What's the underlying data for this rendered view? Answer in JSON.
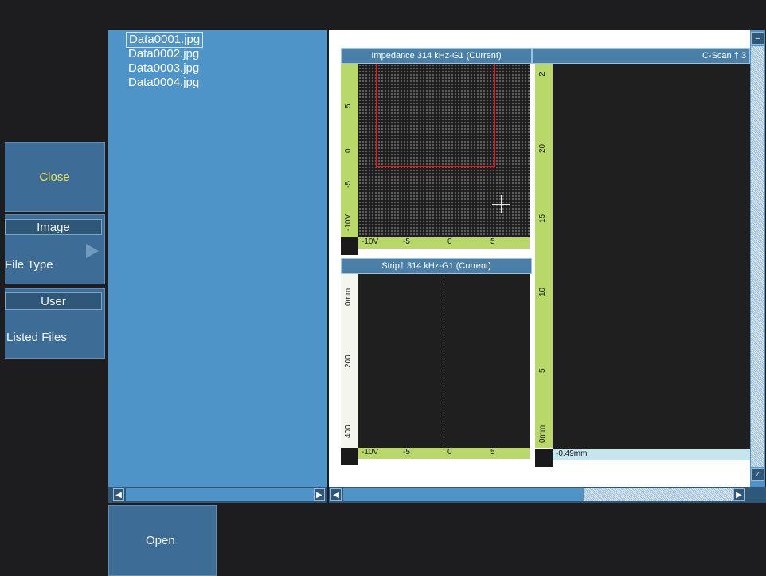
{
  "menu": {
    "close_label": "Close",
    "image_label": "Image",
    "file_type_label": "File Type",
    "user_label": "User",
    "listed_files_label": "Listed Files"
  },
  "files": [
    {
      "name": "Data0001.jpg",
      "selected": true
    },
    {
      "name": "Data0002.jpg",
      "selected": false
    },
    {
      "name": "Data0003.jpg",
      "selected": false
    },
    {
      "name": "Data0004.jpg",
      "selected": false
    }
  ],
  "footer": {
    "open_label": "Open"
  },
  "preview": {
    "impedance_title": "Impedance 314 kHz-G1 (Current)",
    "strip_title": "Strip† 314 kHz-G1 (Current)",
    "cscan_title": "C-Scan † 3",
    "impedance_y_ticks": [
      "-10V",
      "-5",
      "0",
      "5"
    ],
    "impedance_x_ticks": [
      "-10V",
      "-5",
      "0",
      "5"
    ],
    "strip_y_ticks": [
      "0mm",
      "200",
      "400"
    ],
    "strip_x_ticks": [
      "-10V",
      "-5",
      "0",
      "5"
    ],
    "cscan_y_ticks": [
      "0mm",
      "5",
      "10",
      "15",
      "20",
      "2"
    ],
    "cscan_x_readout": "-0.49mm"
  },
  "colors": {
    "background": "#1d1d1f",
    "menu_button": "#3d6d96",
    "file_list": "#4f94c9",
    "ruler": "#b8d86a",
    "close_text": "#f0e04a",
    "lissajous_box": "#d32020"
  }
}
